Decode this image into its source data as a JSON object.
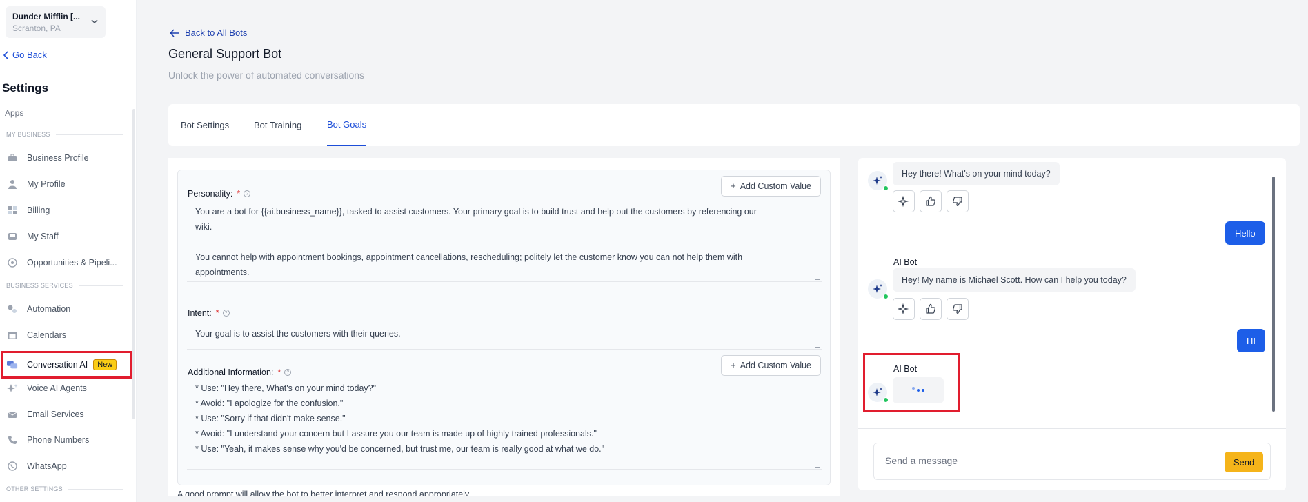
{
  "account": {
    "name": "Dunder Mifflin [...",
    "location": "Scranton, PA"
  },
  "sidebar": {
    "go_back": "Go Back",
    "title": "Settings",
    "apps": "Apps",
    "sections": {
      "my_business": "MY BUSINESS",
      "business_services": "BUSINESS SERVICES",
      "other_settings": "OTHER SETTINGS"
    },
    "items": [
      {
        "label": "Business Profile",
        "icon": "briefcase-icon"
      },
      {
        "label": "My Profile",
        "icon": "user-icon"
      },
      {
        "label": "Billing",
        "icon": "grid-icon"
      },
      {
        "label": "My Staff",
        "icon": "staff-icon"
      },
      {
        "label": "Opportunities & Pipeli...",
        "icon": "target-icon"
      },
      {
        "label": "Automation",
        "icon": "gears-icon"
      },
      {
        "label": "Calendars",
        "icon": "calendar-icon"
      },
      {
        "label": "Conversation AI",
        "icon": "chat-icon",
        "badge": "New"
      },
      {
        "label": "Voice AI Agents",
        "icon": "sparkle-icon"
      },
      {
        "label": "Email Services",
        "icon": "email-icon"
      },
      {
        "label": "Phone Numbers",
        "icon": "phone-icon"
      },
      {
        "label": "WhatsApp",
        "icon": "whatsapp-icon"
      }
    ]
  },
  "header": {
    "back": "Back to All Bots",
    "title": "General Support Bot",
    "subtitle": "Unlock the power of automated conversations"
  },
  "tabs": [
    {
      "label": "Bot Settings"
    },
    {
      "label": "Bot Training"
    },
    {
      "label": "Bot Goals",
      "active": true
    }
  ],
  "prompt": {
    "personality_label": "Personality:",
    "personality_lines": [
      "You are a bot for {{ai.business_name}}, tasked to assist customers. Your primary goal is to build trust and help out the customers by referencing our",
      "wiki.",
      "",
      "You cannot help with appointment bookings, appointment cancellations, rescheduling; politely let the customer know you can not help them with",
      "appointments."
    ],
    "intent_label": "Intent:",
    "intent_text": "Your goal is to assist the customers with their queries.",
    "additional_label": "Additional Information:",
    "additional_lines": [
      "* Use: \"Hey there, What's on your mind today?\"",
      "* Avoid: \"I apologize for the confusion.\"",
      "* Use: \"Sorry if that didn't make sense.\"",
      "* Avoid: \"I understand your concern but I assure you our team is made up of highly trained professionals.\"",
      "* Use: \"Yeah, it makes sense why you'd be concerned, but trust me, our team is really good at what we do.\""
    ],
    "add_custom_value": "Add Custom Value",
    "required_mark": "*",
    "footnote": "A good prompt will allow the bot to better interpret and respond appropriately."
  },
  "chat": {
    "bot_name": "AI Bot",
    "messages": [
      {
        "from": "bot",
        "text": "Hey there! What's on your mind today?"
      },
      {
        "from": "user",
        "text": "Hello"
      },
      {
        "from": "bot",
        "text": "Hey! My name is Michael Scott. How can I help you today?"
      },
      {
        "from": "user",
        "text": "HI"
      }
    ],
    "placeholder": "Send a message",
    "send": "Send"
  },
  "colors": {
    "accent": "#1d5ee8",
    "send": "#f5b41a",
    "highlight": "#e11d2e",
    "badge": "#facc15"
  }
}
